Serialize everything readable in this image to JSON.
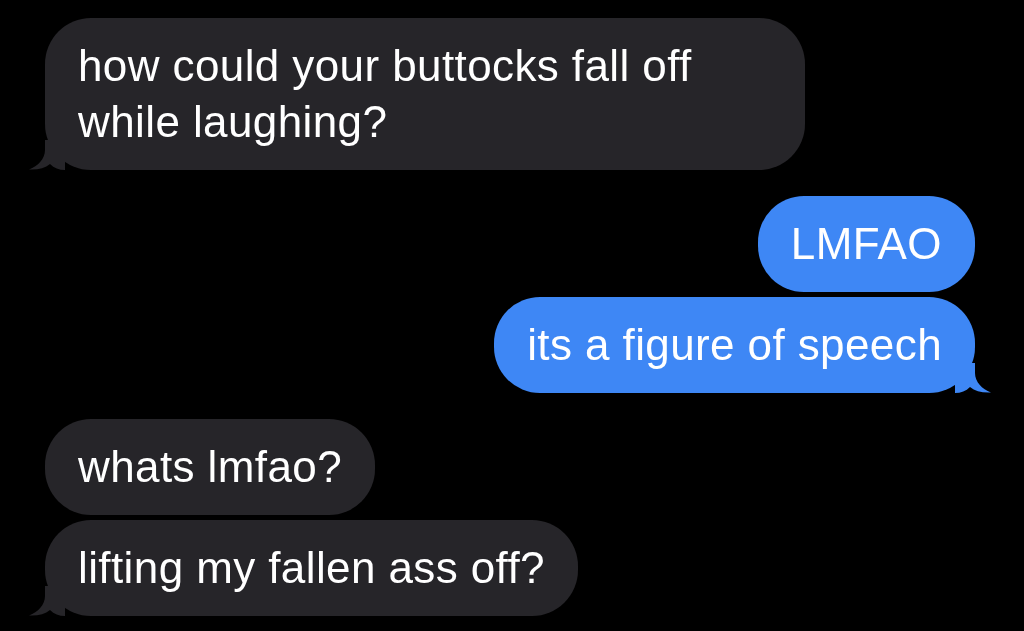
{
  "messages": [
    {
      "kind": "received",
      "text": "how could your buttocks fall off while laughing?",
      "tail": true
    },
    {
      "kind": "sent",
      "text": "LMFAO",
      "tail": false
    },
    {
      "kind": "sent",
      "text": "its a figure of speech",
      "tail": true
    },
    {
      "kind": "received",
      "text": "whats lmfao?",
      "tail": false
    },
    {
      "kind": "received",
      "text": "lifting my fallen ass off?",
      "tail": true
    }
  ]
}
